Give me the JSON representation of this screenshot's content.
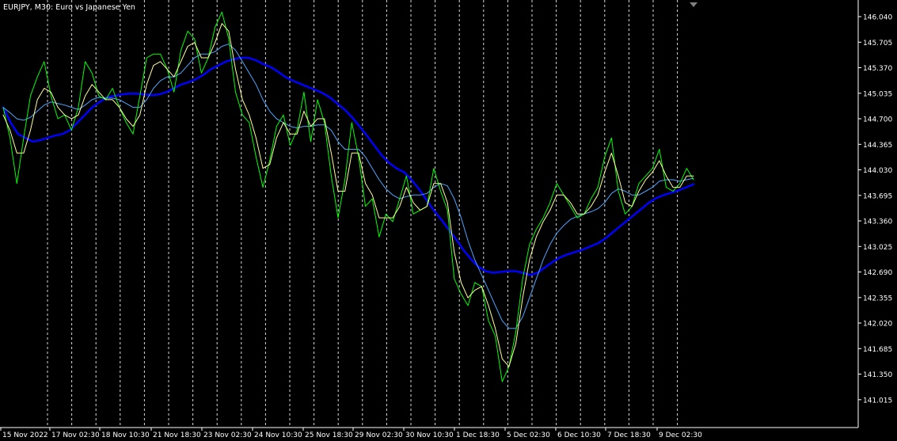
{
  "header": {
    "title": "EURJPY, M30:  Euro vs Japanese Yen"
  },
  "colors": {
    "background": "#000000",
    "grid": "#ffffff",
    "axis": "#ffffff",
    "text": "#ffffff",
    "price": "#00ff00",
    "ma_fast": "#ffff99",
    "ma_mid": "#4da6ff",
    "ma_slow": "#0000ff",
    "marker": "#808080"
  },
  "chart_data": {
    "type": "line",
    "symbol": "EURJPY",
    "timeframe": "M30",
    "title": "EURJPY, M30:  Euro vs Japanese Yen",
    "grid": true,
    "grid_style": "vertical dashed",
    "ylim": [
      140.88,
      146.16
    ],
    "y_ticks": [
      "146.040",
      "145.705",
      "145.370",
      "145.035",
      "144.700",
      "144.365",
      "144.030",
      "143.695",
      "143.360",
      "143.025",
      "142.690",
      "142.355",
      "142.020",
      "141.685",
      "141.350",
      "141.015"
    ],
    "x_ticks": [
      "15 Nov 2022",
      "17 Nov 02:30",
      "18 Nov 10:30",
      "21 Nov 18:30",
      "23 Nov 02:30",
      "24 Nov 10:30",
      "25 Nov 18:30",
      "29 Nov 02:30",
      "30 Nov 10:30",
      "1 Dec 18:30",
      "5 Dec 02:30",
      "6 Dec 10:30",
      "7 Dec 18:30",
      "9 Dec 02:30"
    ],
    "series": [
      {
        "id": "price",
        "color": "#00ff00",
        "values": [
          144.85,
          144.45,
          143.85,
          144.45,
          145.0,
          145.25,
          145.45,
          145.0,
          144.7,
          144.75,
          144.55,
          144.85,
          145.45,
          145.3,
          145.0,
          144.95,
          145.1,
          144.85,
          144.65,
          144.5,
          145.0,
          145.5,
          145.55,
          145.55,
          145.35,
          145.05,
          145.6,
          145.85,
          145.75,
          145.3,
          145.5,
          145.9,
          146.1,
          145.75,
          145.05,
          144.75,
          144.65,
          144.2,
          143.8,
          144.15,
          144.6,
          144.75,
          144.35,
          144.55,
          145.05,
          144.4,
          144.95,
          144.65,
          143.95,
          143.4,
          143.9,
          144.65,
          144.2,
          143.55,
          143.65,
          143.15,
          143.45,
          143.35,
          143.65,
          143.95,
          143.45,
          143.5,
          143.55,
          144.05,
          143.75,
          143.5,
          142.6,
          142.4,
          142.25,
          142.55,
          142.5,
          142.05,
          141.85,
          141.25,
          141.45,
          141.9,
          142.6,
          143.05,
          143.25,
          143.4,
          143.6,
          143.85,
          143.7,
          143.55,
          143.4,
          143.45,
          143.65,
          143.8,
          144.2,
          144.45,
          143.75,
          143.45,
          143.55,
          143.85,
          143.95,
          144.05,
          144.3,
          143.8,
          143.75,
          143.85,
          144.05,
          143.9
        ]
      },
      {
        "id": "ma_fast",
        "color": "#ffff99",
        "values": [
          144.75,
          144.55,
          144.25,
          144.25,
          144.55,
          144.95,
          145.1,
          145.05,
          144.85,
          144.75,
          144.7,
          144.75,
          145.0,
          145.15,
          145.05,
          144.95,
          144.95,
          144.85,
          144.7,
          144.6,
          144.75,
          145.15,
          145.4,
          145.45,
          145.35,
          145.25,
          145.45,
          145.65,
          145.7,
          145.5,
          145.5,
          145.7,
          145.95,
          145.85,
          145.35,
          144.95,
          144.75,
          144.45,
          144.05,
          144.1,
          144.45,
          144.65,
          144.5,
          144.5,
          144.8,
          144.6,
          144.7,
          144.7,
          144.25,
          143.75,
          143.75,
          144.25,
          144.25,
          143.85,
          143.7,
          143.4,
          143.4,
          143.4,
          143.55,
          143.8,
          143.6,
          143.5,
          143.55,
          143.85,
          143.85,
          143.6,
          142.95,
          142.55,
          142.35,
          142.45,
          142.5,
          142.25,
          141.95,
          141.55,
          141.45,
          141.75,
          142.35,
          142.85,
          143.15,
          143.35,
          143.5,
          143.7,
          143.7,
          143.6,
          143.45,
          143.45,
          143.55,
          143.7,
          144.0,
          144.25,
          143.95,
          143.6,
          143.55,
          143.75,
          143.9,
          144.0,
          144.15,
          143.95,
          143.8,
          143.8,
          143.95,
          143.95
        ]
      },
      {
        "id": "ma_mid",
        "color": "#4da6ff",
        "values": [
          144.85,
          144.78,
          144.7,
          144.68,
          144.72,
          144.8,
          144.88,
          144.92,
          144.9,
          144.88,
          144.85,
          144.82,
          144.88,
          144.95,
          144.98,
          144.97,
          144.97,
          144.95,
          144.9,
          144.85,
          144.85,
          144.95,
          145.1,
          145.2,
          145.25,
          145.25,
          145.3,
          145.4,
          145.5,
          145.55,
          145.55,
          145.58,
          145.65,
          145.68,
          145.6,
          145.45,
          145.3,
          145.15,
          144.95,
          144.8,
          144.7,
          144.65,
          144.6,
          144.58,
          144.6,
          144.6,
          144.62,
          144.62,
          144.55,
          144.4,
          144.3,
          144.3,
          144.3,
          144.2,
          144.05,
          143.9,
          143.78,
          143.7,
          143.65,
          143.68,
          143.7,
          143.7,
          143.72,
          143.8,
          143.85,
          143.82,
          143.65,
          143.4,
          143.1,
          142.85,
          142.65,
          142.45,
          142.25,
          142.05,
          141.95,
          141.95,
          142.1,
          142.35,
          142.6,
          142.85,
          143.05,
          143.2,
          143.3,
          143.38,
          143.42,
          143.45,
          143.48,
          143.52,
          143.6,
          143.72,
          143.78,
          143.75,
          143.7,
          143.7,
          143.75,
          143.8,
          143.88,
          143.9,
          143.9,
          143.88,
          143.9,
          143.92
        ]
      },
      {
        "id": "ma_slow",
        "color": "#0000ff",
        "values": [
          144.85,
          144.65,
          144.5,
          144.45,
          144.4,
          144.42,
          144.45,
          144.48,
          144.5,
          144.55,
          144.65,
          144.75,
          144.85,
          144.92,
          144.98,
          145.0,
          145.02,
          145.03,
          145.03,
          145.02,
          145.01,
          145.02,
          145.05,
          145.1,
          145.15,
          145.18,
          145.22,
          145.28,
          145.35,
          145.4,
          145.45,
          145.48,
          145.5,
          145.5,
          145.47,
          145.42,
          145.38,
          145.32,
          145.25,
          145.2,
          145.16,
          145.12,
          145.08,
          145.04,
          144.98,
          144.9,
          144.82,
          144.72,
          144.6,
          144.48,
          144.35,
          144.22,
          144.12,
          144.05,
          144.0,
          143.9,
          143.78,
          143.64,
          143.5,
          143.38,
          143.25,
          143.12,
          142.98,
          142.86,
          142.76,
          142.7,
          142.68,
          142.69,
          142.7,
          142.7,
          142.68,
          142.65,
          142.68,
          142.75,
          142.82,
          142.88,
          142.92,
          142.95,
          142.98,
          143.02,
          143.06,
          143.12,
          143.2,
          143.28,
          143.36,
          143.44,
          143.52,
          143.6,
          143.66,
          143.7,
          143.73,
          143.76,
          143.8,
          143.84
        ]
      }
    ]
  }
}
